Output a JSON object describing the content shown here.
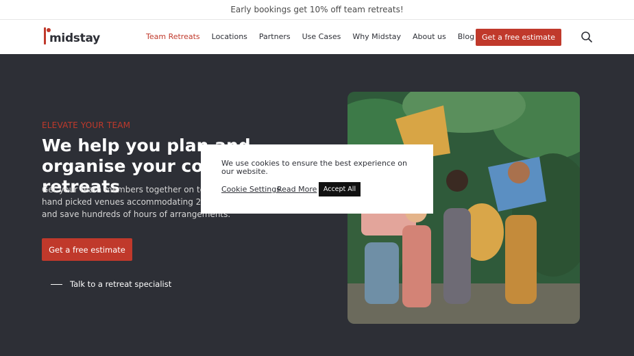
{
  "announcement": {
    "text": "Early bookings get 10% off team retreats!"
  },
  "nav": {
    "logo_text": "midstay",
    "items": [
      {
        "label": "Team Retreats",
        "active": true
      },
      {
        "label": "Locations"
      },
      {
        "label": "Partners"
      },
      {
        "label": "Use Cases"
      },
      {
        "label": "Why Midstay"
      },
      {
        "label": "About us"
      },
      {
        "label": "Blog"
      }
    ],
    "cta_label": "Get a free estimate",
    "search_icon": "search-icon"
  },
  "hero": {
    "eyebrow": "ELEVATE YOUR TEAM",
    "headline": "We help you plan and organise your company retreats",
    "paragraph": "Get your team members together on team retreats with hand picked venues accommodating 200+ employees and save hundreds of hours of arrangements.",
    "cta_label": "Get a free estimate",
    "talk_label": "Talk to a retreat specialist",
    "photo_alt": "Team holding speech bubble signs"
  },
  "cookie": {
    "message": "We use cookies to ensure the best experience on our website.",
    "settings_label": "Cookie Settings",
    "read_more_label": "Read More",
    "accept_label": "Accept All"
  },
  "colors": {
    "accent": "#c0392b",
    "dark_bg": "#2d2f36",
    "white": "#ffffff"
  }
}
